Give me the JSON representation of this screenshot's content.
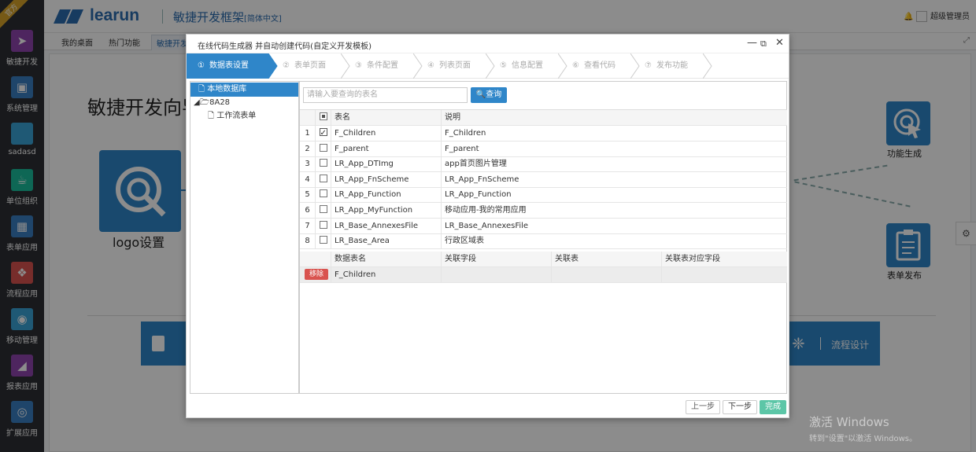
{
  "sidebar": {
    "ribbon": "官方",
    "items": [
      {
        "label": "敏捷开发",
        "icon": "paper-plane-icon",
        "color": "#8e44ad"
      },
      {
        "label": "系统管理",
        "icon": "monitor-icon",
        "color": "#3a7fc1"
      },
      {
        "label": "sadasd",
        "icon": "blank-icon",
        "color": "#3aa3d6"
      },
      {
        "label": "单位组织",
        "icon": "cup-icon",
        "color": "#1abc9c"
      },
      {
        "label": "表单应用",
        "icon": "table-icon",
        "color": "#3a7fc1"
      },
      {
        "label": "流程应用",
        "icon": "share-icon",
        "color": "#d9534f"
      },
      {
        "label": "移动管理",
        "icon": "android-icon",
        "color": "#3aa3d6"
      },
      {
        "label": "报表应用",
        "icon": "chart-icon",
        "color": "#8e44ad"
      },
      {
        "label": "扩展应用",
        "icon": "globe-icon",
        "color": "#3a7fc1"
      }
    ]
  },
  "header": {
    "brand": "learun",
    "subtitle": "敏捷开发框架",
    "lang": "[简体中文]",
    "user": "超级管理员"
  },
  "tabs": [
    "我的桌面",
    "热门功能",
    "敏捷开发"
  ],
  "guide": {
    "title": "敏捷开发向导",
    "logo_label": "logo设置",
    "right_top_label": "功能生成",
    "right_bottom_label": "表单发布",
    "flow_design_label": "流程设计"
  },
  "watermark": {
    "line1": "激活 Windows",
    "line2": "转到\"设置\"以激活 Windows。"
  },
  "modal": {
    "title": "在线代码生成器 并自动创建代码(自定义开发模板)",
    "steps": [
      {
        "num": "①",
        "label": "数据表设置"
      },
      {
        "num": "②",
        "label": "表单页面"
      },
      {
        "num": "③",
        "label": "条件配置"
      },
      {
        "num": "④",
        "label": "列表页面"
      },
      {
        "num": "⑤",
        "label": "信息配置"
      },
      {
        "num": "⑥",
        "label": "查看代码"
      },
      {
        "num": "⑦",
        "label": "发布功能"
      }
    ],
    "tree": {
      "root": "本地数据库",
      "node": "8A28",
      "leaf": "工作流表单"
    },
    "search": {
      "placeholder": "请输入要查询的表名",
      "button": "查询"
    },
    "grid": {
      "headers": {
        "name": "表名",
        "desc": "说明"
      },
      "rows": [
        {
          "n": "1",
          "checked": true,
          "name": "F_Children",
          "desc": "F_Children"
        },
        {
          "n": "2",
          "checked": false,
          "name": "F_parent",
          "desc": "F_parent"
        },
        {
          "n": "3",
          "checked": false,
          "name": "LR_App_DTImg",
          "desc": "app首页图片管理"
        },
        {
          "n": "4",
          "checked": false,
          "name": "LR_App_FnScheme",
          "desc": "LR_App_FnScheme"
        },
        {
          "n": "5",
          "checked": false,
          "name": "LR_App_Function",
          "desc": "LR_App_Function"
        },
        {
          "n": "6",
          "checked": false,
          "name": "LR_App_MyFunction",
          "desc": "移动应用-我的常用应用"
        },
        {
          "n": "7",
          "checked": false,
          "name": "LR_Base_AnnexesFile",
          "desc": "LR_Base_AnnexesFile"
        },
        {
          "n": "8",
          "checked": false,
          "name": "LR_Base_Area",
          "desc": "行政区域表"
        }
      ]
    },
    "relation": {
      "headers": [
        "数据表名",
        "关联字段",
        "关联表",
        "关联表对应字段"
      ],
      "row": {
        "remove": "移除",
        "table": "F_Children"
      }
    },
    "footer": {
      "prev": "上一步",
      "next": "下一步",
      "finish": "完成"
    }
  }
}
